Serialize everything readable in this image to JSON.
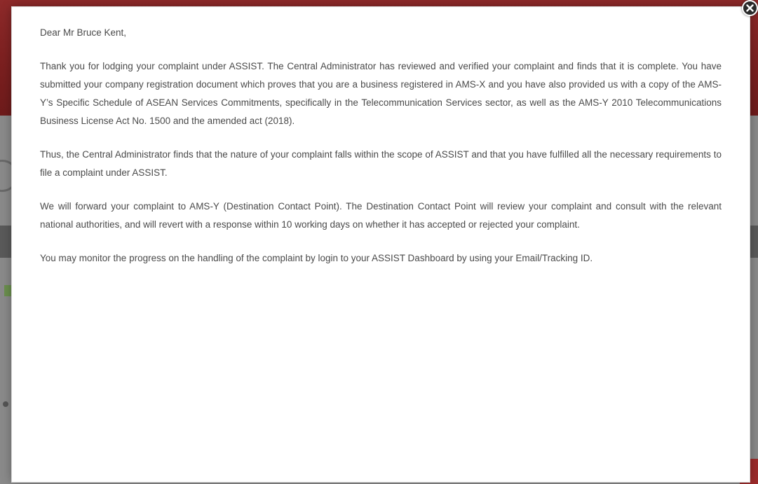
{
  "modal": {
    "salutation": "Dear Mr Bruce Kent,",
    "paragraphs": [
      "Thank you for lodging your complaint under ASSIST. The Central Administrator has reviewed and verified your complaint and finds that it is complete. You have submitted your company registration document which proves that you are a business registered in AMS-X and you have also provided us with a copy of the AMS-Y’s Specific Schedule of ASEAN Services Commitments, specifically in the Telecommunication Services sector, as well as the AMS-Y 2010 Telecommunications Business License Act No. 1500 and the amended act (2018).",
      "Thus, the Central Administrator finds that the nature of your complaint falls within the scope of ASSIST and that you have fulfilled all the necessary requirements to file a complaint under ASSIST.",
      "We will forward your complaint to AMS-Y (Destination Contact Point). The Destination Contact Point will review your complaint and consult with the relevant national authorities, and will revert with a response within 10 working days on whether it has accepted or rejected your complaint.",
      "You may monitor the progress on the handling of the complaint by login to your ASSIST Dashboard by using your Email/Tracking ID."
    ]
  },
  "close_button": {
    "icon": "close-icon"
  },
  "colors": {
    "header_red": "#7a1f1f",
    "modal_background": "#ffffff",
    "text": "#4a4a4a",
    "close_button": "#2a2a2a"
  }
}
